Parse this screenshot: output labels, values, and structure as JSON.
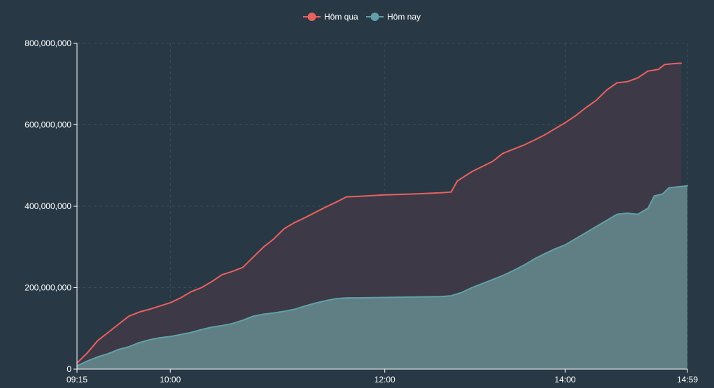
{
  "chart_data": {
    "type": "area",
    "title": "",
    "xlabel": "",
    "ylabel": "",
    "x_ticks": [
      "09:15",
      "10:00",
      "12:00",
      "14:00",
      "14:59"
    ],
    "y_ticks": [
      "0",
      "200,000,000",
      "400,000,000",
      "600,000,000",
      "800,000,000"
    ],
    "ylim": [
      0,
      800000000
    ],
    "grid": true,
    "legend_position": "top-center",
    "series": [
      {
        "name": "Hôm qua",
        "color": "#e8615f",
        "fill": "#3e3947",
        "points": [
          [
            "09:15",
            15000000
          ],
          [
            "09:20",
            40000000
          ],
          [
            "09:25",
            70000000
          ],
          [
            "09:30",
            90000000
          ],
          [
            "09:35",
            110000000
          ],
          [
            "09:40",
            130000000
          ],
          [
            "09:45",
            140000000
          ],
          [
            "09:50",
            147000000
          ],
          [
            "09:55",
            155000000
          ],
          [
            "10:00",
            163000000
          ],
          [
            "10:05",
            175000000
          ],
          [
            "10:10",
            190000000
          ],
          [
            "10:15",
            200000000
          ],
          [
            "10:20",
            215000000
          ],
          [
            "10:25",
            232000000
          ],
          [
            "10:30",
            240000000
          ],
          [
            "10:35",
            250000000
          ],
          [
            "10:40",
            275000000
          ],
          [
            "10:45",
            300000000
          ],
          [
            "10:50",
            320000000
          ],
          [
            "10:55",
            345000000
          ],
          [
            "11:00",
            360000000
          ],
          [
            "11:05",
            372000000
          ],
          [
            "11:10",
            385000000
          ],
          [
            "11:15",
            398000000
          ],
          [
            "11:20",
            410000000
          ],
          [
            "11:25",
            423000000
          ],
          [
            "11:30",
            424000000
          ],
          [
            "11:45",
            426000000
          ],
          [
            "12:00",
            428000000
          ],
          [
            "12:30",
            430000000
          ],
          [
            "13:00",
            433000000
          ],
          [
            "13:05",
            435000000
          ],
          [
            "13:08",
            462000000
          ],
          [
            "13:15",
            485000000
          ],
          [
            "13:25",
            510000000
          ],
          [
            "13:30",
            530000000
          ],
          [
            "13:35",
            540000000
          ],
          [
            "13:40",
            550000000
          ],
          [
            "13:45",
            562000000
          ],
          [
            "13:50",
            575000000
          ],
          [
            "13:55",
            590000000
          ],
          [
            "14:00",
            605000000
          ],
          [
            "14:05",
            622000000
          ],
          [
            "14:10",
            642000000
          ],
          [
            "14:15",
            660000000
          ],
          [
            "14:20",
            685000000
          ],
          [
            "14:25",
            703000000
          ],
          [
            "14:30",
            706000000
          ],
          [
            "14:35",
            715000000
          ],
          [
            "14:40",
            732000000
          ],
          [
            "14:45",
            736000000
          ],
          [
            "14:48",
            748000000
          ],
          [
            "14:52",
            750000000
          ],
          [
            "14:55",
            751000000
          ],
          [
            "14:56",
            751000000
          ]
        ]
      },
      {
        "name": "Hôm nay",
        "color": "#61a0a8",
        "fill": "#5f7f84",
        "points": [
          [
            "09:15",
            8000000
          ],
          [
            "09:20",
            20000000
          ],
          [
            "09:25",
            30000000
          ],
          [
            "09:30",
            38000000
          ],
          [
            "09:35",
            48000000
          ],
          [
            "09:40",
            55000000
          ],
          [
            "09:45",
            65000000
          ],
          [
            "09:50",
            72000000
          ],
          [
            "09:55",
            77000000
          ],
          [
            "10:00",
            80000000
          ],
          [
            "10:05",
            85000000
          ],
          [
            "10:10",
            90000000
          ],
          [
            "10:15",
            97000000
          ],
          [
            "10:20",
            103000000
          ],
          [
            "10:25",
            107000000
          ],
          [
            "10:30",
            112000000
          ],
          [
            "10:35",
            120000000
          ],
          [
            "10:40",
            130000000
          ],
          [
            "10:45",
            135000000
          ],
          [
            "10:50",
            138000000
          ],
          [
            "10:55",
            142000000
          ],
          [
            "11:00",
            147000000
          ],
          [
            "11:05",
            155000000
          ],
          [
            "11:10",
            162000000
          ],
          [
            "11:15",
            168000000
          ],
          [
            "11:20",
            173000000
          ],
          [
            "11:25",
            175000000
          ],
          [
            "11:30",
            175000000
          ],
          [
            "12:00",
            176000000
          ],
          [
            "12:30",
            177000000
          ],
          [
            "13:00",
            178000000
          ],
          [
            "13:05",
            180000000
          ],
          [
            "13:10",
            188000000
          ],
          [
            "13:15",
            200000000
          ],
          [
            "13:20",
            210000000
          ],
          [
            "13:25",
            220000000
          ],
          [
            "13:30",
            230000000
          ],
          [
            "13:35",
            242000000
          ],
          [
            "13:40",
            255000000
          ],
          [
            "13:45",
            270000000
          ],
          [
            "13:50",
            283000000
          ],
          [
            "13:55",
            295000000
          ],
          [
            "14:00",
            305000000
          ],
          [
            "14:05",
            320000000
          ],
          [
            "14:10",
            335000000
          ],
          [
            "14:15",
            350000000
          ],
          [
            "14:20",
            365000000
          ],
          [
            "14:25",
            380000000
          ],
          [
            "14:30",
            383000000
          ],
          [
            "14:35",
            380000000
          ],
          [
            "14:40",
            395000000
          ],
          [
            "14:43",
            425000000
          ],
          [
            "14:47",
            430000000
          ],
          [
            "14:50",
            445000000
          ],
          [
            "14:55",
            448000000
          ],
          [
            "14:59",
            450000000
          ]
        ]
      }
    ]
  }
}
